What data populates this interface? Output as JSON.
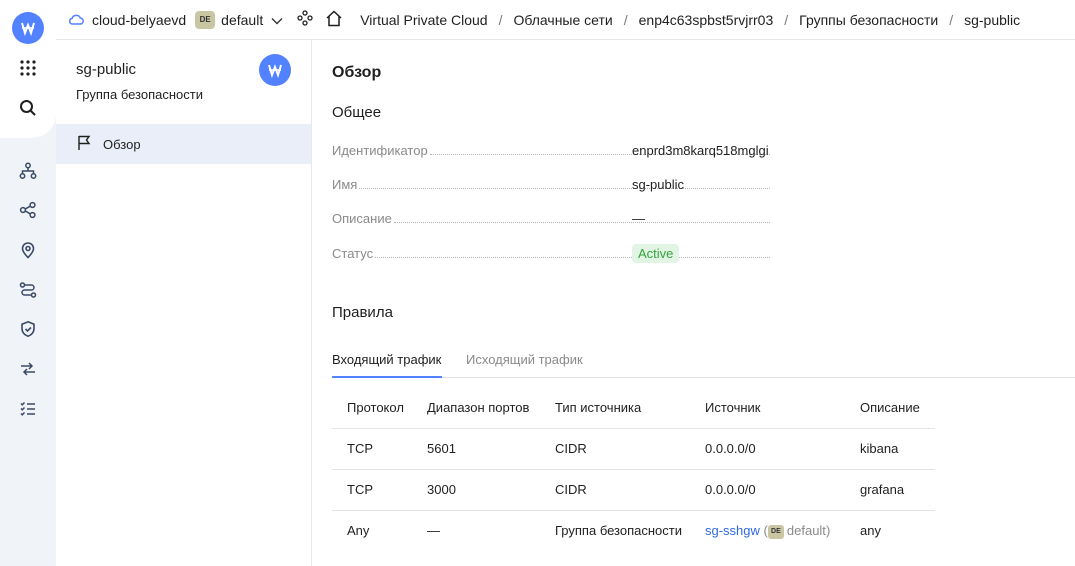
{
  "topbar": {
    "cloud_name": "cloud-belyaevd",
    "folder_badge": "DE",
    "folder_name": "default",
    "breadcrumbs": [
      "Virtual Private Cloud",
      "Облачные сети",
      "enp4c63spbst5rvjrr03",
      "Группы безопасности",
      "sg-public"
    ]
  },
  "rail": {
    "icons": [
      "logo-icon",
      "apps-grid-icon",
      "search-icon",
      "network-icon",
      "share-icon",
      "location-pin-icon",
      "route-icon",
      "shield-icon",
      "transfer-arrows-icon",
      "checklist-icon"
    ]
  },
  "sidebar": {
    "title": "sg-public",
    "subtitle": "Группа безопасности",
    "items": [
      {
        "label": "Обзор",
        "icon": "flag-icon",
        "active": true
      }
    ]
  },
  "main": {
    "page_title": "Обзор",
    "general_title": "Общее",
    "fields": [
      {
        "key": "Идентификатор",
        "value": "enprd3m8karq518mglgi"
      },
      {
        "key": "Имя",
        "value": "sg-public"
      },
      {
        "key": "Описание",
        "value": "—"
      },
      {
        "key": "Статус",
        "value": "Active"
      }
    ],
    "rules_title": "Правила",
    "tabs": [
      {
        "label": "Входящий трафик",
        "active": true
      },
      {
        "label": "Исходящий трафик",
        "active": false
      }
    ],
    "table": {
      "headers": [
        "Протокол",
        "Диапазон портов",
        "Тип источника",
        "Источник",
        "Описание"
      ],
      "rows": [
        {
          "protocol": "TCP",
          "ports": "5601",
          "source_type": "CIDR",
          "source": "0.0.0.0/0",
          "description": "kibana"
        },
        {
          "protocol": "TCP",
          "ports": "3000",
          "source_type": "CIDR",
          "source": "0.0.0.0/0",
          "description": "grafana"
        },
        {
          "protocol": "Any",
          "ports": "—",
          "source_type": "Группа безопасности",
          "source": "sg-sshgw",
          "source_badge": "DE",
          "source_folder": "default",
          "description": "any"
        }
      ]
    }
  },
  "colors": {
    "accent": "#5282ff",
    "status_active_bg": "#e2f5e5",
    "status_active_text": "#35a33c",
    "link": "#2f6ae0"
  }
}
